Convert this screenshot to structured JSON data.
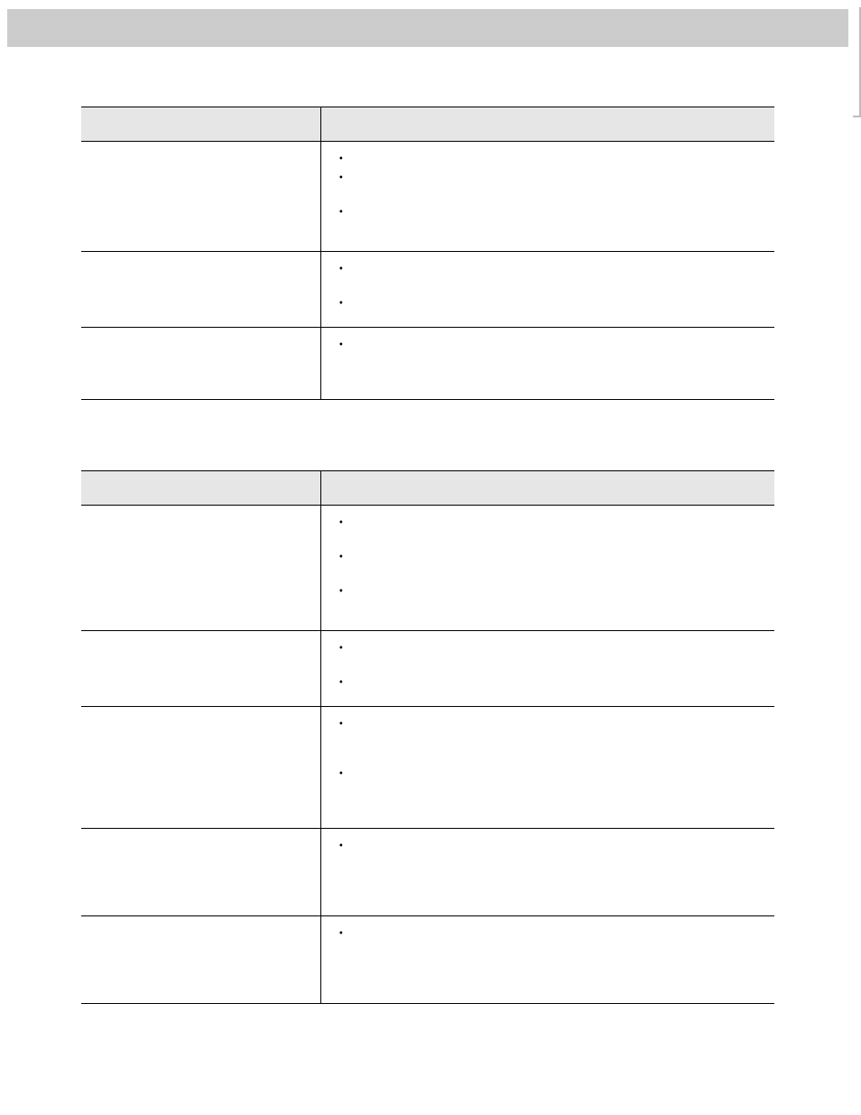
{
  "header": {
    "text": ""
  },
  "sections": [
    {
      "title": "",
      "columns": [
        "",
        ""
      ],
      "rows": [
        {
          "label": "",
          "bullets": [
            {
              "text": "",
              "lines": 1
            },
            {
              "text": "",
              "lines": 2
            },
            {
              "text": "",
              "lines": 2
            }
          ]
        },
        {
          "label": "",
          "bullets": [
            {
              "text": "",
              "lines": 2
            },
            {
              "text": "",
              "lines": 1
            }
          ]
        },
        {
          "label": "",
          "bullets": [
            {
              "text": "",
              "lines": 3
            }
          ]
        }
      ]
    },
    {
      "title": "",
      "columns": [
        "",
        ""
      ],
      "rows": [
        {
          "label": "",
          "bullets": [
            {
              "text": "",
              "lines": 2
            },
            {
              "text": "",
              "lines": 2
            },
            {
              "text": "",
              "lines": 2
            }
          ]
        },
        {
          "label": "",
          "bullets": [
            {
              "text": "",
              "lines": 2
            },
            {
              "text": "",
              "lines": 1
            }
          ]
        },
        {
          "label": "",
          "bullets": [
            {
              "text": "",
              "lines": 3
            },
            {
              "text": "",
              "lines": 3
            }
          ]
        },
        {
          "label": "",
          "bullets": [
            {
              "text": "",
              "lines": 4
            }
          ]
        },
        {
          "label": "",
          "bullets": [
            {
              "text": "",
              "lines": 4
            }
          ]
        }
      ]
    }
  ]
}
